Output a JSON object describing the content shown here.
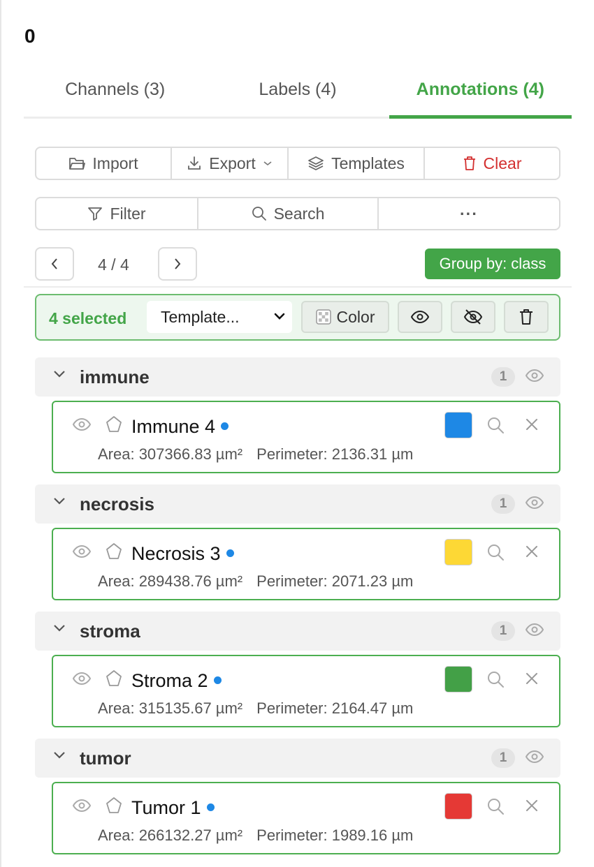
{
  "panel": {
    "id_label": "0"
  },
  "tabs": [
    {
      "label": "Channels (3)",
      "active": false
    },
    {
      "label": "Labels (4)",
      "active": false
    },
    {
      "label": "Annotations (4)",
      "active": true
    }
  ],
  "toolbar": {
    "import_label": "Import",
    "export_label": "Export",
    "templates_label": "Templates",
    "clear_label": "Clear",
    "filter_label": "Filter",
    "search_label": "Search",
    "more_label": "···"
  },
  "pagination": {
    "indicator": "4 / 4",
    "group_by_label": "Group by: class"
  },
  "selection": {
    "count_label": "4 selected",
    "template_select_value": "Template...",
    "color_label": "Color"
  },
  "groups": [
    {
      "name": "immune",
      "count": "1",
      "annotation": {
        "name": "Immune 4",
        "color": "#1e88e5",
        "area": "Area: 307366.83 µm²",
        "perimeter": "Perimeter: 2136.31 µm"
      }
    },
    {
      "name": "necrosis",
      "count": "1",
      "annotation": {
        "name": "Necrosis 3",
        "color": "#fdd835",
        "area": "Area: 289438.76 µm²",
        "perimeter": "Perimeter: 2071.23 µm"
      }
    },
    {
      "name": "stroma",
      "count": "1",
      "annotation": {
        "name": "Stroma 2",
        "color": "#43a047",
        "area": "Area: 315135.67 µm²",
        "perimeter": "Perimeter: 2164.47 µm"
      }
    },
    {
      "name": "tumor",
      "count": "1",
      "annotation": {
        "name": "Tumor 1",
        "color": "#e53935",
        "area": "Area: 266132.27 µm²",
        "perimeter": "Perimeter: 1989.16 µm"
      }
    }
  ],
  "colors": {
    "accent": "#43a548",
    "danger": "#d32f2f",
    "unsaved_dot": "#1e88e5"
  },
  "icons": [
    "folder-open-icon",
    "download-icon",
    "layers-icon",
    "trash-icon",
    "filter-icon",
    "search-icon",
    "ellipsis-icon",
    "chevron-left-icon",
    "chevron-right-icon",
    "checkerboard-icon",
    "eye-icon",
    "eye-off-icon",
    "chevron-down-icon",
    "polygon-icon",
    "close-icon"
  ]
}
